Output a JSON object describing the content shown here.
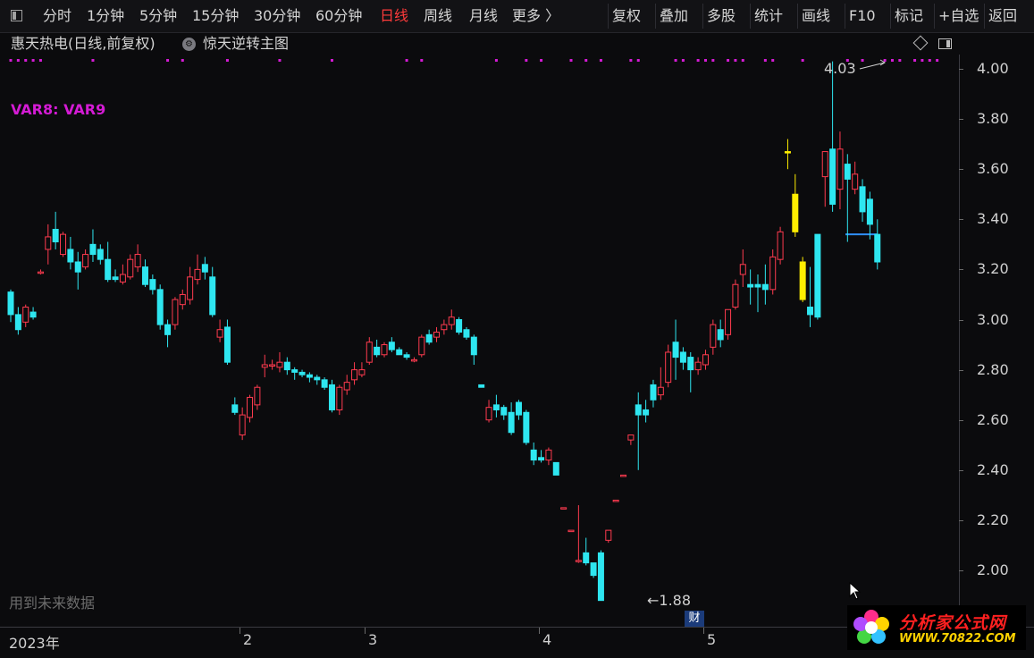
{
  "toolbar": {
    "periods": [
      "分时",
      "1分钟",
      "5分钟",
      "15分钟",
      "30分钟",
      "60分钟",
      "日线",
      "周线",
      "月线",
      "更多 〉"
    ],
    "active": "日线",
    "right_buttons": [
      "复权",
      "叠加",
      "多股",
      "统计",
      "画线",
      "F10",
      "标记",
      "+自选",
      "返回"
    ]
  },
  "title": {
    "stock": "惠天热电(日线,前复权)",
    "formula": "惊天逆转主图"
  },
  "indicator_label": "VAR8: VAR9",
  "watermark": "用到未来数据",
  "price_axis": [
    "4.00",
    "3.80",
    "3.60",
    "3.40",
    "3.20",
    "3.00",
    "2.80",
    "2.60",
    "2.40",
    "2.20",
    "2.00"
  ],
  "annotations": {
    "high": "4.03",
    "low": "←1.88",
    "cai": "财"
  },
  "date_axis": [
    "2023年",
    "2",
    "3",
    "4",
    "5"
  ],
  "logo": {
    "name": "分析家公式网",
    "url": "WWW.70822.COM"
  },
  "colors": {
    "up": "#ff3b4f",
    "down": "#2ee6f0",
    "signal": "#d41bd4",
    "highlight": "#ffee00",
    "band": "#2f8fff"
  },
  "chart_data": {
    "type": "candlestick",
    "ylim": [
      1.85,
      4.1
    ],
    "candles": [
      [
        3.11,
        3.12,
        3.02,
        2.99
      ],
      [
        3.02,
        3.05,
        2.96,
        2.94
      ],
      [
        2.99,
        3.06,
        3.05,
        2.97
      ],
      [
        3.03,
        3.05,
        3.01,
        3.0
      ],
      [
        3.19,
        3.2,
        3.19,
        3.18
      ],
      [
        3.28,
        3.38,
        3.33,
        3.22
      ],
      [
        3.36,
        3.43,
        3.31,
        3.28
      ],
      [
        3.26,
        3.35,
        3.34,
        3.25
      ],
      [
        3.28,
        3.33,
        3.23,
        3.2
      ],
      [
        3.23,
        3.27,
        3.19,
        3.12
      ],
      [
        3.21,
        3.28,
        3.26,
        3.2
      ],
      [
        3.3,
        3.36,
        3.26,
        3.23
      ],
      [
        3.28,
        3.3,
        3.24,
        3.22
      ],
      [
        3.24,
        3.31,
        3.16,
        3.15
      ],
      [
        3.17,
        3.2,
        3.16,
        3.15
      ],
      [
        3.15,
        3.22,
        3.18,
        3.14
      ],
      [
        3.17,
        3.26,
        3.24,
        3.16
      ],
      [
        3.21,
        3.3,
        3.26,
        3.19
      ],
      [
        3.21,
        3.24,
        3.14,
        3.13
      ],
      [
        3.16,
        3.18,
        3.12,
        3.1
      ],
      [
        3.12,
        3.14,
        2.98,
        2.96
      ],
      [
        2.98,
        3.0,
        2.94,
        2.89
      ],
      [
        2.98,
        3.09,
        3.08,
        2.96
      ],
      [
        3.06,
        3.12,
        3.1,
        3.04
      ],
      [
        3.08,
        3.21,
        3.17,
        3.06
      ],
      [
        3.16,
        3.26,
        3.2,
        3.14
      ],
      [
        3.22,
        3.25,
        3.19,
        3.16
      ],
      [
        3.17,
        3.21,
        3.02,
        3.01
      ],
      [
        2.93,
        3.0,
        2.96,
        2.91
      ],
      [
        2.97,
        3.0,
        2.83,
        2.82
      ],
      [
        2.66,
        2.69,
        2.63,
        2.62
      ],
      [
        2.54,
        2.65,
        2.62,
        2.52
      ],
      [
        2.61,
        2.7,
        2.69,
        2.59
      ],
      [
        2.66,
        2.74,
        2.73,
        2.64
      ],
      [
        2.81,
        2.86,
        2.82,
        2.77
      ],
      [
        2.82,
        2.84,
        2.82,
        2.8
      ],
      [
        2.81,
        2.87,
        2.83,
        2.79
      ],
      [
        2.83,
        2.85,
        2.8,
        2.78
      ],
      [
        2.8,
        2.81,
        2.79,
        2.76
      ],
      [
        2.79,
        2.8,
        2.78,
        2.77
      ],
      [
        2.78,
        2.79,
        2.77,
        2.75
      ],
      [
        2.77,
        2.78,
        2.76,
        2.74
      ],
      [
        2.76,
        2.77,
        2.73,
        2.72
      ],
      [
        2.74,
        2.76,
        2.64,
        2.63
      ],
      [
        2.64,
        2.74,
        2.73,
        2.62
      ],
      [
        2.72,
        2.78,
        2.75,
        2.7
      ],
      [
        2.76,
        2.83,
        2.8,
        2.74
      ],
      [
        2.78,
        2.83,
        2.8,
        2.77
      ],
      [
        2.83,
        2.93,
        2.91,
        2.82
      ],
      [
        2.89,
        2.92,
        2.86,
        2.85
      ],
      [
        2.86,
        2.91,
        2.9,
        2.85
      ],
      [
        2.91,
        2.93,
        2.88,
        2.87
      ],
      [
        2.88,
        2.89,
        2.86,
        2.86
      ],
      [
        2.86,
        2.87,
        2.85,
        2.84
      ],
      [
        2.84,
        2.85,
        2.84,
        2.83
      ],
      [
        2.86,
        2.94,
        2.93,
        2.85
      ],
      [
        2.94,
        2.96,
        2.91,
        2.9
      ],
      [
        2.93,
        2.97,
        2.95,
        2.91
      ],
      [
        2.96,
        3.0,
        2.98,
        2.94
      ],
      [
        2.98,
        3.04,
        3.01,
        2.96
      ],
      [
        3.0,
        3.01,
        2.95,
        2.94
      ],
      [
        2.96,
        2.97,
        2.93,
        2.92
      ],
      [
        2.93,
        2.94,
        2.86,
        2.82
      ],
      [
        2.74,
        2.74,
        2.73,
        2.73
      ],
      [
        2.6,
        2.68,
        2.65,
        2.59
      ],
      [
        2.66,
        2.7,
        2.64,
        2.61
      ],
      [
        2.65,
        2.66,
        2.62,
        2.6
      ],
      [
        2.63,
        2.67,
        2.55,
        2.54
      ],
      [
        2.67,
        2.68,
        2.62,
        2.6
      ],
      [
        2.63,
        2.64,
        2.51,
        2.5
      ],
      [
        2.48,
        2.51,
        2.44,
        2.42
      ],
      [
        2.45,
        2.48,
        2.44,
        2.43
      ],
      [
        2.44,
        2.49,
        2.48,
        2.42
      ],
      [
        2.43,
        2.43,
        2.38,
        2.38
      ],
      [
        2.25,
        2.25,
        2.25,
        2.25
      ],
      [
        2.16,
        2.16,
        2.16,
        2.16
      ],
      [
        2.04,
        2.26,
        2.04,
        2.03
      ],
      [
        2.07,
        2.13,
        2.03,
        2.02
      ],
      [
        2.03,
        2.03,
        1.98,
        1.97
      ],
      [
        2.07,
        2.08,
        1.88,
        1.88
      ],
      [
        2.12,
        2.16,
        2.16,
        2.11
      ],
      [
        2.28,
        2.28,
        2.28,
        2.28
      ],
      [
        2.38,
        2.38,
        2.38,
        2.38
      ],
      [
        2.52,
        2.54,
        2.54,
        2.5
      ],
      [
        2.66,
        2.71,
        2.62,
        2.4
      ],
      [
        2.64,
        2.68,
        2.62,
        2.59
      ],
      [
        2.74,
        2.76,
        2.68,
        2.65
      ],
      [
        2.7,
        2.81,
        2.73,
        2.68
      ],
      [
        2.75,
        2.9,
        2.87,
        2.73
      ],
      [
        2.91,
        3.0,
        2.85,
        2.76
      ],
      [
        2.87,
        2.89,
        2.83,
        2.8
      ],
      [
        2.85,
        2.87,
        2.8,
        2.71
      ],
      [
        2.8,
        2.85,
        2.83,
        2.78
      ],
      [
        2.82,
        2.88,
        2.86,
        2.8
      ],
      [
        2.89,
        3.0,
        2.98,
        2.86
      ],
      [
        2.96,
        3.0,
        2.92,
        2.89
      ],
      [
        2.94,
        3.02,
        3.04,
        2.92
      ],
      [
        3.05,
        3.16,
        3.14,
        3.04
      ],
      [
        3.18,
        3.28,
        3.22,
        3.13
      ],
      [
        3.14,
        3.2,
        3.13,
        3.06
      ],
      [
        3.14,
        3.18,
        3.13,
        3.03
      ],
      [
        3.14,
        3.22,
        3.12,
        3.06
      ],
      [
        3.12,
        3.28,
        3.25,
        3.1
      ],
      [
        3.24,
        3.37,
        3.35,
        3.22
      ],
      [
        3.67,
        3.72,
        3.67,
        3.6
      ],
      [
        3.5,
        3.58,
        3.35,
        3.33
      ],
      [
        3.23,
        3.25,
        3.08,
        3.07
      ],
      [
        3.05,
        3.21,
        3.02,
        2.97
      ],
      [
        3.34,
        3.34,
        3.01,
        3.0
      ],
      [
        3.57,
        3.67,
        3.67,
        3.45
      ],
      [
        3.68,
        4.03,
        3.46,
        3.43
      ],
      [
        3.52,
        3.75,
        3.68,
        3.44
      ],
      [
        3.62,
        3.66,
        3.56,
        3.31
      ],
      [
        3.52,
        3.63,
        3.58,
        3.5
      ],
      [
        3.53,
        3.56,
        3.43,
        3.39
      ],
      [
        3.48,
        3.51,
        3.38,
        3.32
      ],
      [
        3.34,
        3.4,
        3.23,
        3.2
      ]
    ],
    "highlight_candles": [
      104,
      105,
      106
    ],
    "signal_dots": [
      0,
      1,
      2,
      3,
      4,
      11,
      21,
      23,
      29,
      36,
      43,
      53,
      55,
      65,
      69,
      71,
      75,
      77,
      79,
      83,
      84,
      89,
      90,
      92,
      93,
      94,
      96,
      97,
      98,
      101,
      102,
      106,
      112,
      114,
      117,
      118,
      119,
      121,
      122,
      123,
      124
    ]
  }
}
